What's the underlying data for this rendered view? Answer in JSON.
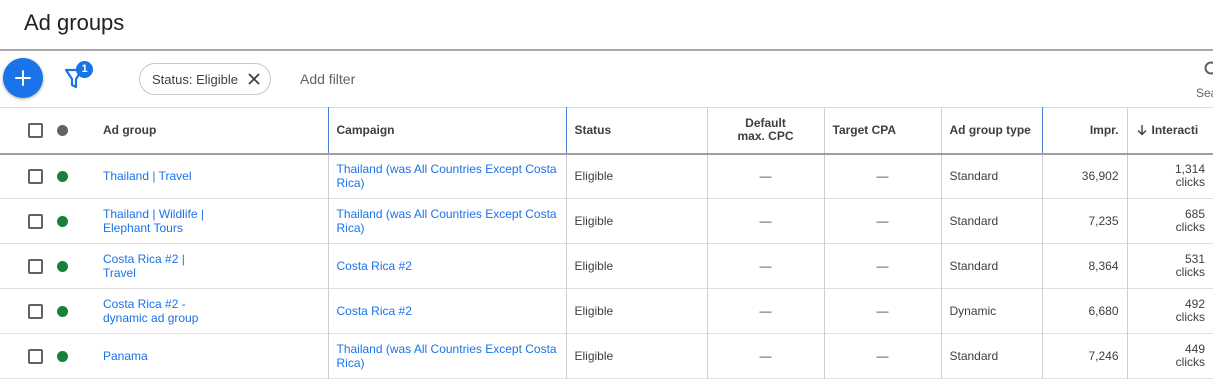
{
  "page": {
    "title": "Ad groups"
  },
  "toolbar": {
    "filter_count": "1",
    "chip_label": "Status: Eligible",
    "add_filter_label": "Add filter",
    "search_label": "Sea"
  },
  "table": {
    "headers": {
      "ad_group": "Ad group",
      "campaign": "Campaign",
      "status": "Status",
      "default_cpc_line1": "Default",
      "default_cpc_line2": "max. CPC",
      "target_cpa": "Target CPA",
      "ad_group_type": "Ad group type",
      "impr": "Impr.",
      "interactions": "Interacti"
    },
    "rows": [
      {
        "ad_group": "Thailand | Travel",
        "campaign": "Thailand (was All Countries Except Costa Rica)",
        "status": "Eligible",
        "cpc": "—",
        "cpa": "—",
        "type": "Standard",
        "impr": "36,902",
        "inter_value": "1,314",
        "inter_unit": "clicks"
      },
      {
        "ad_group": "Thailand | Wildlife | Elephant Tours",
        "campaign": "Thailand (was All Countries Except Costa Rica)",
        "status": "Eligible",
        "cpc": "—",
        "cpa": "—",
        "type": "Standard",
        "impr": "7,235",
        "inter_value": "685",
        "inter_unit": "clicks"
      },
      {
        "ad_group": "Costa Rica #2 | Travel",
        "campaign": "Costa Rica #2",
        "status": "Eligible",
        "cpc": "—",
        "cpa": "—",
        "type": "Standard",
        "impr": "8,364",
        "inter_value": "531",
        "inter_unit": "clicks"
      },
      {
        "ad_group": "Costa Rica #2 - dynamic ad group",
        "campaign": "Costa Rica #2",
        "status": "Eligible",
        "cpc": "—",
        "cpa": "—",
        "type": "Dynamic",
        "impr": "6,680",
        "inter_value": "492",
        "inter_unit": "clicks"
      },
      {
        "ad_group": "Panama",
        "campaign": "Thailand (was All Countries Except Costa Rica)",
        "status": "Eligible",
        "cpc": "—",
        "cpa": "—",
        "type": "Standard",
        "impr": "7,246",
        "inter_value": "449",
        "inter_unit": "clicks"
      }
    ]
  },
  "colors": {
    "accent": "#1a73e8",
    "status_green": "#188038",
    "text": "#3c4043"
  },
  "icons": {
    "add": "plus-icon",
    "filter": "filter-icon",
    "chip_remove": "close-icon",
    "search": "search-icon",
    "sort": "arrow-down-icon"
  }
}
